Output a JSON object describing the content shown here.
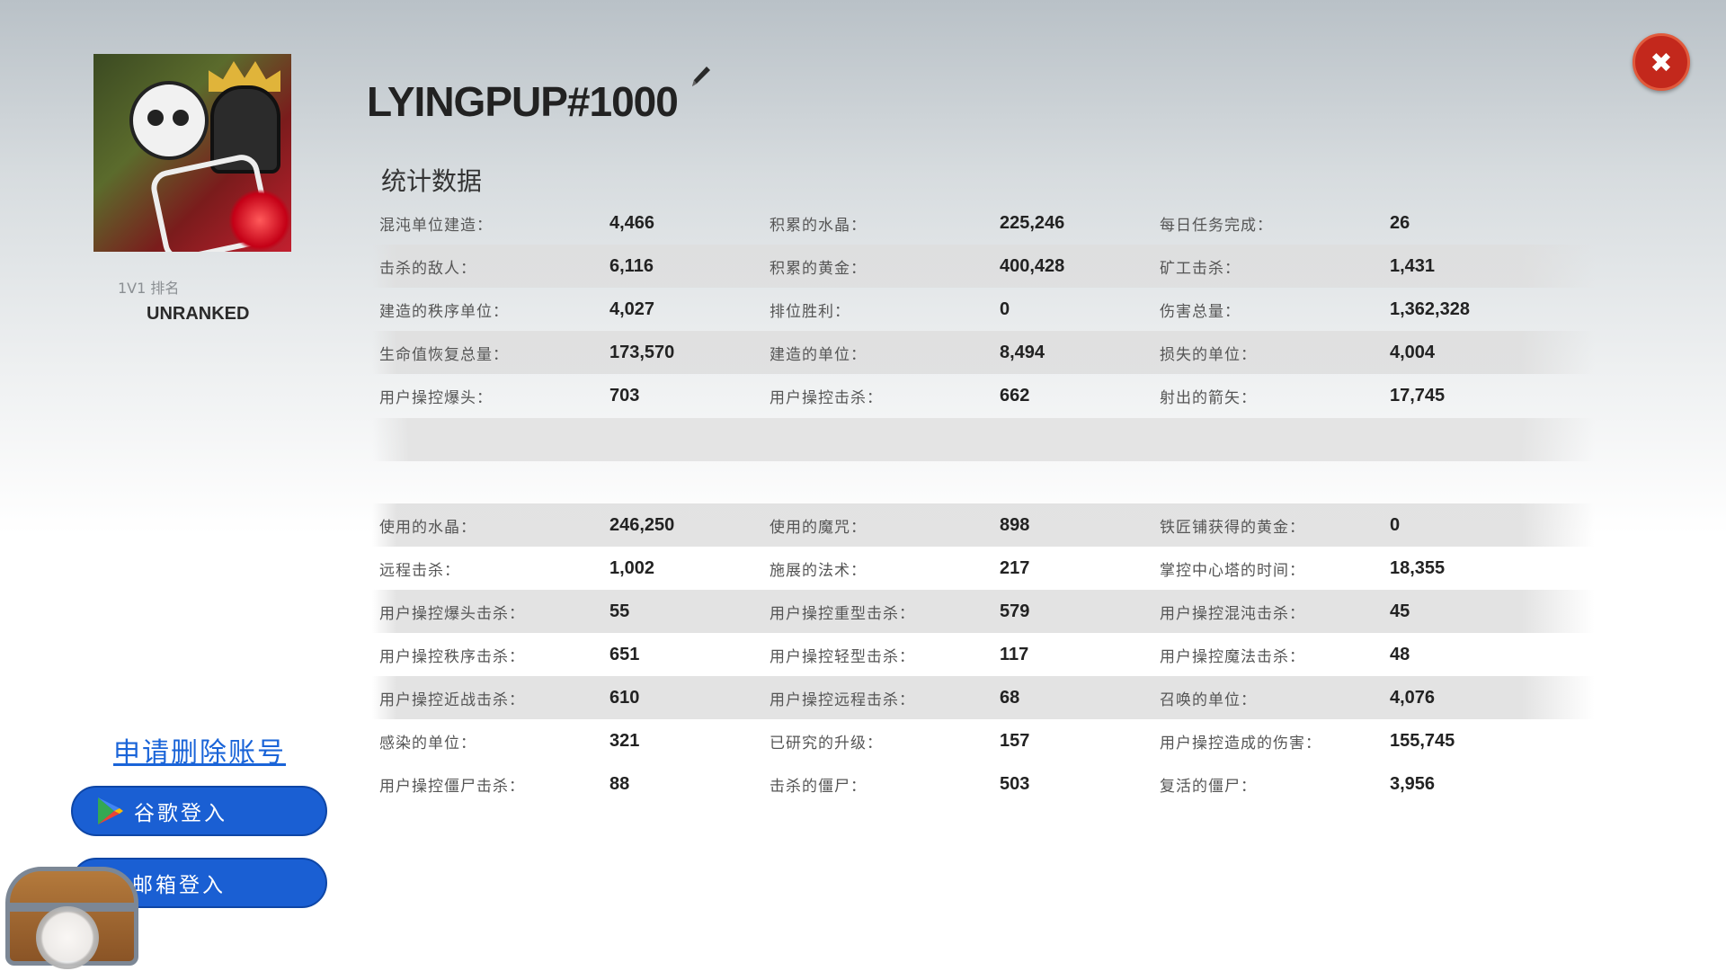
{
  "profile": {
    "player_name": "LYINGPUP#1000",
    "rank_label": "1V1 排名",
    "rank_value": "UNRANKED"
  },
  "stats": {
    "title": "统计数据",
    "group1": [
      [
        {
          "label": "混沌单位建造：",
          "value": "4,466"
        },
        {
          "label": "积累的水晶：",
          "value": "225,246"
        },
        {
          "label": "每日任务完成：",
          "value": "26"
        }
      ],
      [
        {
          "label": "击杀的敌人：",
          "value": "6,116"
        },
        {
          "label": "积累的黄金：",
          "value": "400,428"
        },
        {
          "label": "矿工击杀：",
          "value": "1,431"
        }
      ],
      [
        {
          "label": "建造的秩序单位：",
          "value": "4,027"
        },
        {
          "label": "排位胜利：",
          "value": "0"
        },
        {
          "label": "伤害总量：",
          "value": "1,362,328"
        }
      ],
      [
        {
          "label": "生命值恢复总量：",
          "value": "173,570"
        },
        {
          "label": "建造的单位：",
          "value": "8,494"
        },
        {
          "label": "损失的单位：",
          "value": "4,004"
        }
      ],
      [
        {
          "label": "用户操控爆头：",
          "value": "703"
        },
        {
          "label": "用户操控击杀：",
          "value": "662"
        },
        {
          "label": "射出的箭矢：",
          "value": "17,745"
        }
      ]
    ],
    "group2": [
      [
        {
          "label": "使用的水晶：",
          "value": "246,250"
        },
        {
          "label": "使用的魔咒：",
          "value": "898"
        },
        {
          "label": "铁匠铺获得的黄金：",
          "value": "0"
        }
      ],
      [
        {
          "label": "远程击杀：",
          "value": "1,002"
        },
        {
          "label": "施展的法术：",
          "value": "217"
        },
        {
          "label": "掌控中心塔的时间：",
          "value": "18,355"
        }
      ],
      [
        {
          "label": "用户操控爆头击杀：",
          "value": "55"
        },
        {
          "label": "用户操控重型击杀：",
          "value": "579"
        },
        {
          "label": "用户操控混沌击杀：",
          "value": "45"
        }
      ],
      [
        {
          "label": "用户操控秩序击杀：",
          "value": "651"
        },
        {
          "label": "用户操控轻型击杀：",
          "value": "117"
        },
        {
          "label": "用户操控魔法击杀：",
          "value": "48"
        }
      ],
      [
        {
          "label": "用户操控近战击杀：",
          "value": "610"
        },
        {
          "label": "用户操控远程击杀：",
          "value": "68"
        },
        {
          "label": "召唤的单位：",
          "value": "4,076"
        }
      ],
      [
        {
          "label": "感染的单位：",
          "value": "321"
        },
        {
          "label": "已研究的升级：",
          "value": "157"
        },
        {
          "label": "用户操控造成的伤害：",
          "value": "155,745"
        }
      ],
      [
        {
          "label": "用户操控僵尸击杀：",
          "value": "88"
        },
        {
          "label": "击杀的僵尸：",
          "value": "503"
        },
        {
          "label": "复活的僵尸：",
          "value": "3,956"
        }
      ]
    ]
  },
  "account": {
    "delete_link": "申请删除账号",
    "google_login": "谷歌登入",
    "email_login": "邮箱登入"
  },
  "icons": {
    "close": "close-icon",
    "edit": "pencil-icon",
    "google_play": "google-play-icon",
    "chest": "treasure-chest-icon"
  },
  "colors": {
    "close_button": "#c3281c",
    "login_button": "#1a5fd3",
    "link": "#1a64d8"
  }
}
